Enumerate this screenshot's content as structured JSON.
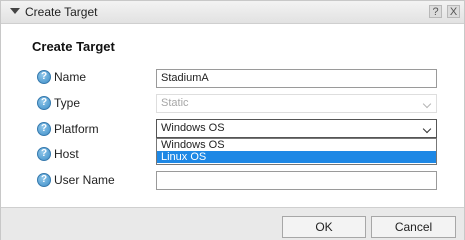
{
  "titlebar": {
    "title": "Create Target",
    "help_label": "?",
    "close_label": "X",
    "collapse_icon": "chevron-down-icon"
  },
  "heading": "Create Target",
  "fields": {
    "name": {
      "label": "Name",
      "value": "StadiumA"
    },
    "type": {
      "label": "Type",
      "value": "Static"
    },
    "platform": {
      "label": "Platform",
      "value": "Windows OS",
      "options": [
        "Windows OS",
        "Linux OS"
      ],
      "highlighted": "Linux OS"
    },
    "host": {
      "label": "Host",
      "value": ""
    },
    "username": {
      "label": "User Name",
      "value": ""
    }
  },
  "help_icon_glyph": "?",
  "buttons": {
    "ok": "OK",
    "cancel": "Cancel"
  },
  "colors": {
    "highlight": "#1e88e5",
    "help_icon": "#3e8fc8"
  }
}
